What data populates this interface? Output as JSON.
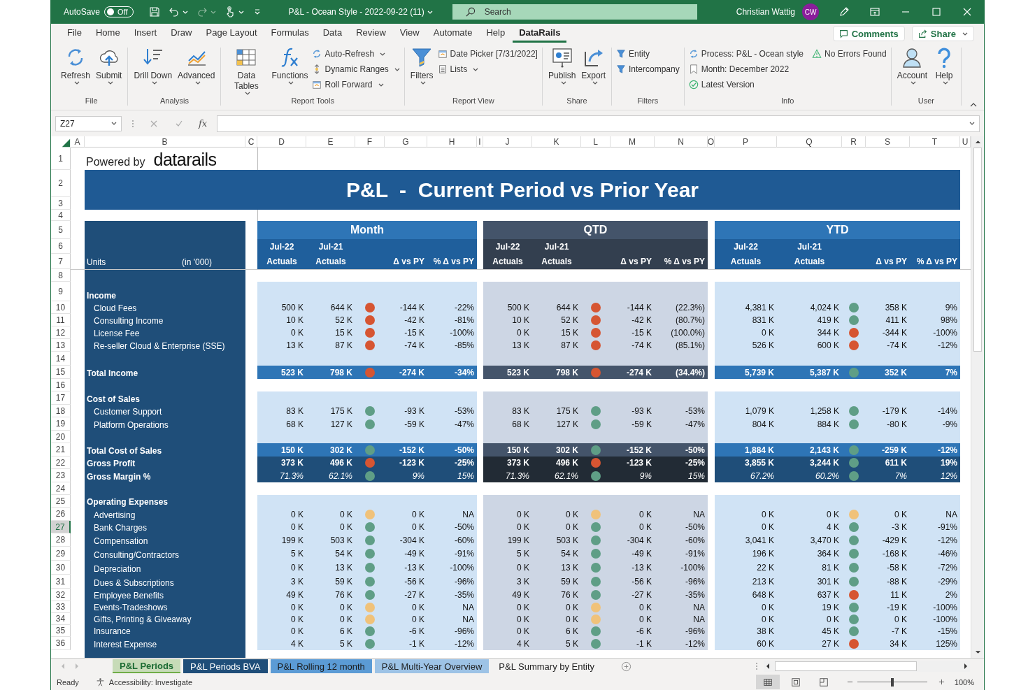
{
  "title_bar": {
    "autosave_label": "AutoSave",
    "autosave_on": false,
    "autosave_state": "Off",
    "document_title": "P&L - Ocean Style - 2022-09-22 (11)",
    "search_placeholder": "Search",
    "user_name": "Christian Wattig",
    "user_initials": "CW"
  },
  "ribbon_tabs": [
    {
      "label": "File",
      "selected": false
    },
    {
      "label": "Home",
      "selected": false
    },
    {
      "label": "Insert",
      "selected": false
    },
    {
      "label": "Draw",
      "selected": false
    },
    {
      "label": "Page Layout",
      "selected": false
    },
    {
      "label": "Formulas",
      "selected": false
    },
    {
      "label": "Data",
      "selected": false
    },
    {
      "label": "Review",
      "selected": false
    },
    {
      "label": "View",
      "selected": false
    },
    {
      "label": "Automate",
      "selected": false
    },
    {
      "label": "Help",
      "selected": false
    },
    {
      "label": "DataRails",
      "selected": true
    }
  ],
  "comments_button": "Comments",
  "share_button": "Share",
  "ribbon_groups": [
    {
      "label": "File",
      "items": [
        {
          "kind": "large",
          "label": "Refresh",
          "dropdown": true
        },
        {
          "kind": "large",
          "label": "Submit",
          "dropdown": true
        }
      ]
    },
    {
      "label": "Analysis",
      "items": [
        {
          "kind": "large",
          "label": "Drill Down",
          "dropdown": true
        },
        {
          "kind": "large",
          "label": "Advanced",
          "dropdown": true
        }
      ]
    },
    {
      "label": "Report Tools",
      "items": [
        {
          "kind": "large",
          "label": "Data Tables",
          "dropdown": true
        },
        {
          "kind": "large",
          "label": "Functions",
          "dropdown": true
        },
        {
          "kind": "small",
          "label": "Auto-Refresh",
          "dropdown": true
        },
        {
          "kind": "small",
          "label": "Dynamic Ranges",
          "dropdown": true
        },
        {
          "kind": "small",
          "label": "Roll Forward",
          "dropdown": true
        }
      ]
    },
    {
      "label": "Report View",
      "items": [
        {
          "kind": "large",
          "label": "Filters",
          "dropdown": true
        },
        {
          "kind": "small",
          "label": "Date Picker [7/31/2022]",
          "dropdown": false
        },
        {
          "kind": "small",
          "label": "Lists",
          "dropdown": true
        }
      ]
    },
    {
      "label": "Share",
      "items": [
        {
          "kind": "large",
          "label": "Publish",
          "dropdown": true
        },
        {
          "kind": "large",
          "label": "Export",
          "dropdown": true
        }
      ]
    },
    {
      "label": "Filters",
      "items": [
        {
          "kind": "small",
          "label": "Entity",
          "dropdown": false
        },
        {
          "kind": "small",
          "label": "Intercompany",
          "dropdown": false
        }
      ]
    },
    {
      "label": "Info",
      "items": [
        {
          "kind": "small",
          "label": "Process: P&L - Ocean style",
          "dropdown": false
        },
        {
          "kind": "small",
          "label": "Month: December 2022",
          "dropdown": false
        },
        {
          "kind": "small",
          "label": "Latest Version",
          "dropdown": false
        },
        {
          "kind": "small",
          "label": "No Errors Found",
          "dropdown": false
        }
      ]
    },
    {
      "label": "User",
      "items": [
        {
          "kind": "large",
          "label": "Account",
          "dropdown": true
        },
        {
          "kind": "large",
          "label": "Help",
          "dropdown": true
        }
      ]
    }
  ],
  "formula_bar": {
    "name_box": "Z27",
    "function_label": "fx"
  },
  "sheet": {
    "column_headers": [
      "A",
      "B",
      "C",
      "D",
      "E",
      "F",
      "G",
      "H",
      "I",
      "J",
      "K",
      "L",
      "M",
      "N",
      "O",
      "P",
      "Q",
      "R",
      "S",
      "T",
      "U"
    ],
    "row_numbers": [
      {
        "label": "1",
        "selected": false
      },
      {
        "label": "2",
        "selected": false
      },
      {
        "label": "3",
        "selected": false
      },
      {
        "label": "4",
        "selected": false
      },
      {
        "label": "5",
        "selected": false
      },
      {
        "label": "6",
        "selected": false
      },
      {
        "label": "7",
        "selected": false
      },
      {
        "label": "8",
        "selected": false
      },
      {
        "label": "9",
        "selected": false
      },
      {
        "label": "10",
        "selected": false
      },
      {
        "label": "11",
        "selected": false
      },
      {
        "label": "12",
        "selected": false
      },
      {
        "label": "13",
        "selected": false
      },
      {
        "label": "14",
        "selected": false
      },
      {
        "label": "15",
        "selected": false
      },
      {
        "label": "16",
        "selected": false
      },
      {
        "label": "17",
        "selected": false
      },
      {
        "label": "18",
        "selected": false
      },
      {
        "label": "19",
        "selected": false
      },
      {
        "label": "20",
        "selected": false
      },
      {
        "label": "21",
        "selected": false
      },
      {
        "label": "22",
        "selected": false
      },
      {
        "label": "23",
        "selected": false
      },
      {
        "label": "24",
        "selected": false
      },
      {
        "label": "25",
        "selected": false
      },
      {
        "label": "26",
        "selected": false
      },
      {
        "label": "27",
        "selected": true
      },
      {
        "label": "28",
        "selected": false
      },
      {
        "label": "29",
        "selected": false
      },
      {
        "label": "30",
        "selected": false
      },
      {
        "label": "31",
        "selected": false
      },
      {
        "label": "32",
        "selected": false
      },
      {
        "label": "33",
        "selected": false
      },
      {
        "label": "34",
        "selected": false
      },
      {
        "label": "35",
        "selected": false
      },
      {
        "label": "36",
        "selected": false
      }
    ],
    "powered_by": "Powered by",
    "logo": "datarails",
    "title": "P&L  -  Current Period vs Prior Year",
    "units_label": "Units",
    "units_note": "(in '000)",
    "sections": [
      {
        "title": "Month",
        "kind": "blue",
        "periods": [
          {
            "period": "Jul-22",
            "basis": "Actuals"
          },
          {
            "period": "Jul-21",
            "basis": "Actuals"
          }
        ],
        "delta": "Δ vs PY",
        "delta_pct": "% Δ vs PY"
      },
      {
        "title": "QTD",
        "kind": "slate",
        "periods": [
          {
            "period": "Jul-22",
            "basis": "Actuals"
          },
          {
            "period": "Jul-21",
            "basis": "Actuals"
          }
        ],
        "delta": "Δ vs PY",
        "delta_pct": "% Δ vs PY"
      },
      {
        "title": "YTD",
        "kind": "blue",
        "periods": [
          {
            "period": "Jul-22",
            "basis": "Actuals"
          },
          {
            "period": "Jul-21",
            "basis": "Actuals"
          }
        ],
        "delta": "Δ vs PY",
        "delta_pct": "% Δ vs PY"
      }
    ],
    "lines": [
      {
        "kind": "gap"
      },
      {
        "kind": "heading",
        "label": "Income"
      },
      {
        "kind": "item",
        "label": "Cloud Fees",
        "cells": [
          {
            "actual": "500 K",
            "prior": "644 K",
            "color": "#d65532",
            "delta": "-144 K",
            "change": "-22%"
          },
          {
            "actual": "500 K",
            "prior": "644 K",
            "color": "#d65532",
            "delta": "-144 K",
            "change": "(22.3%)"
          },
          {
            "actual": "4,381 K",
            "prior": "4,024 K",
            "color": "#5f9e86",
            "delta": "358 K",
            "change": "9%"
          }
        ]
      },
      {
        "kind": "item",
        "label": "Consulting Income",
        "cells": [
          {
            "actual": "10 K",
            "prior": "52 K",
            "color": "#d65532",
            "delta": "-42 K",
            "change": "-81%"
          },
          {
            "actual": "10 K",
            "prior": "52 K",
            "color": "#d65532",
            "delta": "-42 K",
            "change": "(80.7%)"
          },
          {
            "actual": "831 K",
            "prior": "419 K",
            "color": "#5f9e86",
            "delta": "411 K",
            "change": "98%"
          }
        ]
      },
      {
        "kind": "item",
        "label": "License Fee",
        "cells": [
          {
            "actual": "0 K",
            "prior": "15 K",
            "color": "#d65532",
            "delta": "-15 K",
            "change": "-100%"
          },
          {
            "actual": "0 K",
            "prior": "15 K",
            "color": "#d65532",
            "delta": "-15 K",
            "change": "(100.0%)"
          },
          {
            "actual": "0 K",
            "prior": "344 K",
            "color": "#d65532",
            "delta": "-344 K",
            "change": "-100%"
          }
        ]
      },
      {
        "kind": "item",
        "label": "Re-seller Cloud & Enterprise (SSE)",
        "cells": [
          {
            "actual": "13 K",
            "prior": "87 K",
            "color": "#d65532",
            "delta": "-74 K",
            "change": "-85%"
          },
          {
            "actual": "13 K",
            "prior": "87 K",
            "color": "#d65532",
            "delta": "-74 K",
            "change": "(85.1%)"
          },
          {
            "actual": "526 K",
            "prior": "600 K",
            "color": "#d65532",
            "delta": "-74 K",
            "change": "-12%"
          }
        ]
      },
      {
        "kind": "spacer"
      },
      {
        "kind": "total",
        "label": "Total Income",
        "cells": [
          {
            "actual": "523 K",
            "prior": "798 K",
            "color": "#d65532",
            "delta": "-274 K",
            "change": "-34%"
          },
          {
            "actual": "523 K",
            "prior": "798 K",
            "color": "#d65532",
            "delta": "-274 K",
            "change": "(34.4%)"
          },
          {
            "actual": "5,739 K",
            "prior": "5,387 K",
            "color": "#5f9e86",
            "delta": "352 K",
            "change": "7%"
          }
        ]
      },
      {
        "kind": "gap"
      },
      {
        "kind": "heading",
        "label": "Cost of Sales"
      },
      {
        "kind": "item",
        "label": "Customer Support",
        "cells": [
          {
            "actual": "83 K",
            "prior": "175 K",
            "color": "#5f9e86",
            "delta": "-93 K",
            "change": "-53%"
          },
          {
            "actual": "83 K",
            "prior": "175 K",
            "color": "#5f9e86",
            "delta": "-93 K",
            "change": "-53%"
          },
          {
            "actual": "1,079 K",
            "prior": "1,258 K",
            "color": "#5f9e86",
            "delta": "-179 K",
            "change": "-14%"
          }
        ]
      },
      {
        "kind": "item",
        "label": "Platform Operations",
        "cells": [
          {
            "actual": "68 K",
            "prior": "127 K",
            "color": "#5f9e86",
            "delta": "-59 K",
            "change": "-47%"
          },
          {
            "actual": "68 K",
            "prior": "127 K",
            "color": "#5f9e86",
            "delta": "-59 K",
            "change": "-47%"
          },
          {
            "actual": "804 K",
            "prior": "884 K",
            "color": "#5f9e86",
            "delta": "-80 K",
            "change": "-9%"
          }
        ]
      },
      {
        "kind": "spacer"
      },
      {
        "kind": "total",
        "label": "Total Cost of Sales",
        "cells": [
          {
            "actual": "150 K",
            "prior": "302 K",
            "color": "#5f9e86",
            "delta": "-152 K",
            "change": "-50%"
          },
          {
            "actual": "150 K",
            "prior": "302 K",
            "color": "#5f9e86",
            "delta": "-152 K",
            "change": "-50%"
          },
          {
            "actual": "1,884 K",
            "prior": "2,143 K",
            "color": "#5f9e86",
            "delta": "-259 K",
            "change": "-12%"
          }
        ]
      },
      {
        "kind": "key",
        "label": "Gross Profit",
        "cells": [
          {
            "actual": "373 K",
            "prior": "496 K",
            "color": "#d65532",
            "delta": "-123 K",
            "change": "-25%"
          },
          {
            "actual": "373 K",
            "prior": "496 K",
            "color": "#d65532",
            "delta": "-123 K",
            "change": "-25%"
          },
          {
            "actual": "3,855 K",
            "prior": "3,244 K",
            "color": "#5f9e86",
            "delta": "611 K",
            "change": "19%"
          }
        ]
      },
      {
        "kind": "ratio",
        "label": "Gross Margin %",
        "cells": [
          {
            "actual": "71.3%",
            "prior": "62.1%",
            "color": "#5f9e86",
            "delta": "9%",
            "change": "15%"
          },
          {
            "actual": "71.3%",
            "prior": "62.1%",
            "color": "#5f9e86",
            "delta": "9%",
            "change": "15%"
          },
          {
            "actual": "67.2%",
            "prior": "60.2%",
            "color": "#5f9e86",
            "delta": "7%",
            "change": "12%"
          }
        ]
      },
      {
        "kind": "gap"
      },
      {
        "kind": "heading",
        "label": "Operating Expenses"
      },
      {
        "kind": "item",
        "label": "Advertising",
        "cells": [
          {
            "actual": "0 K",
            "prior": "0 K",
            "color": "#f0c27a",
            "delta": "0 K",
            "change": "NA"
          },
          {
            "actual": "0 K",
            "prior": "0 K",
            "color": "#f0c27a",
            "delta": "0 K",
            "change": "NA"
          },
          {
            "actual": "0 K",
            "prior": "0 K",
            "color": "#f0c27a",
            "delta": "0 K",
            "change": "NA"
          }
        ]
      },
      {
        "kind": "item",
        "label": "Bank Charges",
        "cells": [
          {
            "actual": "0 K",
            "prior": "0 K",
            "color": "#5f9e86",
            "delta": "0 K",
            "change": "-50%"
          },
          {
            "actual": "0 K",
            "prior": "0 K",
            "color": "#5f9e86",
            "delta": "0 K",
            "change": "-50%"
          },
          {
            "actual": "0 K",
            "prior": "4 K",
            "color": "#5f9e86",
            "delta": "-3 K",
            "change": "-91%"
          }
        ]
      },
      {
        "kind": "item",
        "label": "Compensation",
        "cells": [
          {
            "actual": "199 K",
            "prior": "503 K",
            "color": "#5f9e86",
            "delta": "-304 K",
            "change": "-60%"
          },
          {
            "actual": "199 K",
            "prior": "503 K",
            "color": "#5f9e86",
            "delta": "-304 K",
            "change": "-60%"
          },
          {
            "actual": "3,041 K",
            "prior": "3,470 K",
            "color": "#5f9e86",
            "delta": "-429 K",
            "change": "-12%"
          }
        ]
      },
      {
        "kind": "item",
        "label": "Consulting/Contractors",
        "cells": [
          {
            "actual": "5 K",
            "prior": "54 K",
            "color": "#5f9e86",
            "delta": "-49 K",
            "change": "-91%"
          },
          {
            "actual": "5 K",
            "prior": "54 K",
            "color": "#5f9e86",
            "delta": "-49 K",
            "change": "-91%"
          },
          {
            "actual": "196 K",
            "prior": "364 K",
            "color": "#5f9e86",
            "delta": "-168 K",
            "change": "-46%"
          }
        ]
      },
      {
        "kind": "item",
        "label": "Depreciation",
        "cells": [
          {
            "actual": "0 K",
            "prior": "13 K",
            "color": "#5f9e86",
            "delta": "-13 K",
            "change": "-100%"
          },
          {
            "actual": "0 K",
            "prior": "13 K",
            "color": "#5f9e86",
            "delta": "-13 K",
            "change": "-100%"
          },
          {
            "actual": "22 K",
            "prior": "81 K",
            "color": "#5f9e86",
            "delta": "-58 K",
            "change": "-72%"
          }
        ]
      },
      {
        "kind": "item",
        "label": "Dues & Subscriptions",
        "cells": [
          {
            "actual": "3 K",
            "prior": "59 K",
            "color": "#5f9e86",
            "delta": "-56 K",
            "change": "-96%"
          },
          {
            "actual": "3 K",
            "prior": "59 K",
            "color": "#5f9e86",
            "delta": "-56 K",
            "change": "-96%"
          },
          {
            "actual": "213 K",
            "prior": "301 K",
            "color": "#5f9e86",
            "delta": "-88 K",
            "change": "-29%"
          }
        ]
      },
      {
        "kind": "item",
        "label": "Employee Benefits",
        "cells": [
          {
            "actual": "49 K",
            "prior": "76 K",
            "color": "#5f9e86",
            "delta": "-27 K",
            "change": "-35%"
          },
          {
            "actual": "49 K",
            "prior": "76 K",
            "color": "#5f9e86",
            "delta": "-27 K",
            "change": "-35%"
          },
          {
            "actual": "648 K",
            "prior": "637 K",
            "color": "#d65532",
            "delta": "11 K",
            "change": "2%"
          }
        ]
      },
      {
        "kind": "item",
        "label": "Events-Tradeshows",
        "cells": [
          {
            "actual": "0 K",
            "prior": "0 K",
            "color": "#f0c27a",
            "delta": "0 K",
            "change": "NA"
          },
          {
            "actual": "0 K",
            "prior": "0 K",
            "color": "#f0c27a",
            "delta": "0 K",
            "change": "NA"
          },
          {
            "actual": "0 K",
            "prior": "19 K",
            "color": "#5f9e86",
            "delta": "-19 K",
            "change": "-100%"
          }
        ]
      },
      {
        "kind": "item",
        "label": "Gifts, Printing & Giveaway",
        "cells": [
          {
            "actual": "0 K",
            "prior": "0 K",
            "color": "#f0c27a",
            "delta": "0 K",
            "change": "NA"
          },
          {
            "actual": "0 K",
            "prior": "0 K",
            "color": "#f0c27a",
            "delta": "0 K",
            "change": "NA"
          },
          {
            "actual": "0 K",
            "prior": "0 K",
            "color": "#5f9e86",
            "delta": "0 K",
            "change": "-100%"
          }
        ]
      },
      {
        "kind": "item",
        "label": "Insurance",
        "cells": [
          {
            "actual": "0 K",
            "prior": "6 K",
            "color": "#5f9e86",
            "delta": "-6 K",
            "change": "-96%"
          },
          {
            "actual": "0 K",
            "prior": "6 K",
            "color": "#5f9e86",
            "delta": "-6 K",
            "change": "-96%"
          },
          {
            "actual": "38 K",
            "prior": "45 K",
            "color": "#5f9e86",
            "delta": "-7 K",
            "change": "-15%"
          }
        ]
      },
      {
        "kind": "item",
        "label": "Interest Expense",
        "cells": [
          {
            "actual": "4 K",
            "prior": "5 K",
            "color": "#5f9e86",
            "delta": "-1 K",
            "change": "-12%"
          },
          {
            "actual": "4 K",
            "prior": "5 K",
            "color": "#5f9e86",
            "delta": "-1 K",
            "change": "-12%"
          },
          {
            "actual": "60 K",
            "prior": "27 K",
            "color": "#d65532",
            "delta": "34 K",
            "change": "125%"
          }
        ]
      }
    ]
  },
  "sheet_tabs": [
    {
      "label": "P&L Periods",
      "selected": true,
      "color": "#70ad47"
    },
    {
      "label": "P&L Periods BVA",
      "selected": false,
      "color": "#1f4e79"
    },
    {
      "label": "P&L Rolling 12 month",
      "selected": false,
      "color": "#5b9bd5"
    },
    {
      "label": "P&L Multi-Year Overview",
      "selected": false,
      "color": "#9dc3e6"
    },
    {
      "label": "P&L Summary by Entity",
      "selected": false
    }
  ],
  "status_bar": {
    "status": "Ready",
    "accessibility": "Accessibility: Investigate",
    "view_buttons": [
      {
        "selected": true
      },
      {
        "selected": false
      },
      {
        "selected": false
      }
    ],
    "zoom": {
      "level": 0.5,
      "label": "100%"
    }
  }
}
